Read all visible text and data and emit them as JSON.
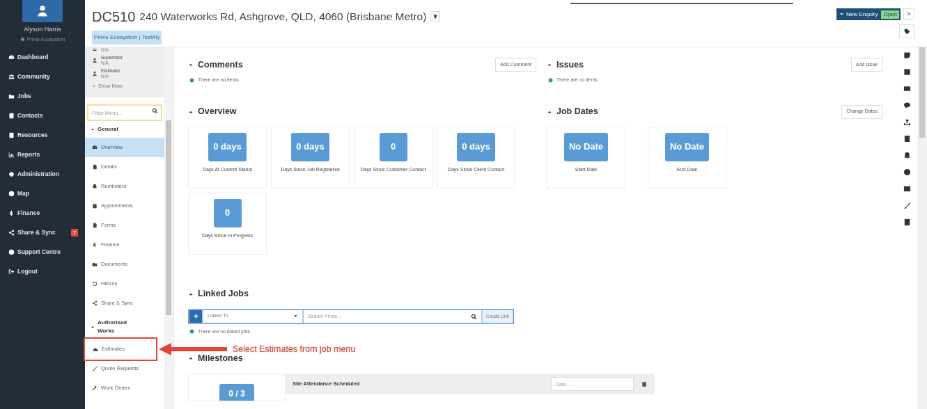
{
  "nav": {
    "user": "Alyson Harris",
    "org": "Prime Ecosystem",
    "items": [
      {
        "label": "Dashboard"
      },
      {
        "label": "Community"
      },
      {
        "label": "Jobs"
      },
      {
        "label": "Contacts"
      },
      {
        "label": "Resources"
      },
      {
        "label": "Reports"
      },
      {
        "label": "Administration"
      },
      {
        "label": "Map"
      },
      {
        "label": "Finance"
      },
      {
        "label": "Share & Sync",
        "badge": "7"
      },
      {
        "label": "Support Centre"
      },
      {
        "label": "Logout"
      }
    ]
  },
  "header": {
    "job_id": "DC510",
    "address": "240 Waterworks Rd, Ashgrove, QLD, 4060 (Brisbane Metro)",
    "tag": "Prime Ecosystem | TestAly",
    "status_button": "New Enquiry",
    "status_badge": "Open",
    "next_button": ">"
  },
  "job_menu": {
    "contacts": [
      {
        "value": "N/A"
      },
      {
        "role": "Supervisor",
        "value": "N/A"
      },
      {
        "role": "Estimator",
        "value": "N/A"
      }
    ],
    "show_more": "Show More",
    "filter_placeholder": "Filter Menu...",
    "groups": [
      {
        "title": "General",
        "items": [
          {
            "label": "Overview",
            "selected": true
          },
          {
            "label": "Details",
            "selected": false
          },
          {
            "label": "Reminders",
            "selected": false
          },
          {
            "label": "Appointments",
            "selected": false
          },
          {
            "label": "Forms",
            "selected": false
          },
          {
            "label": "Finance",
            "selected": false
          },
          {
            "label": "Documents",
            "selected": false
          },
          {
            "label": "History",
            "selected": false
          },
          {
            "label": "Share & Sync",
            "selected": false
          }
        ]
      },
      {
        "title": "Authorised Works",
        "items": [
          {
            "label": "Estimates",
            "selected": false
          },
          {
            "label": "Quote Requests",
            "selected": false
          },
          {
            "label": "Work Orders",
            "selected": false
          }
        ]
      }
    ]
  },
  "comments": {
    "title": "Comments",
    "button": "Add Comment",
    "empty": "There are no items"
  },
  "issues": {
    "title": "Issues",
    "button": "Add Issue",
    "empty": "There are no items"
  },
  "overview": {
    "title": "Overview",
    "cards": [
      {
        "value": "0 days",
        "label": "Days At Current Status"
      },
      {
        "value": "0 days",
        "label": "Days Since Job Registered"
      },
      {
        "value": "0",
        "label": "Days Since Customer Contact"
      },
      {
        "value": "0 days",
        "label": "Days Since Client Contact"
      },
      {
        "value": "0",
        "label": "Days Since In Progress"
      }
    ]
  },
  "job_dates": {
    "title": "Job Dates",
    "button": "Change Dates",
    "cards": [
      {
        "value": "No Date",
        "label": "Start Date"
      },
      {
        "value": "No Date",
        "label": "End Date"
      }
    ]
  },
  "linked_jobs": {
    "title": "Linked Jobs",
    "select": "Linked To",
    "search_placeholder": "Search Prime...",
    "button": "Create Link",
    "empty": "There are no linked jobs"
  },
  "milestones": {
    "title": "Milestones",
    "progress": "0 / 3",
    "rows": [
      {
        "name": "Site Attendance Scheduled",
        "date_placeholder": "Date..."
      }
    ]
  },
  "annotation": {
    "text": "Select Estimates from job menu"
  }
}
